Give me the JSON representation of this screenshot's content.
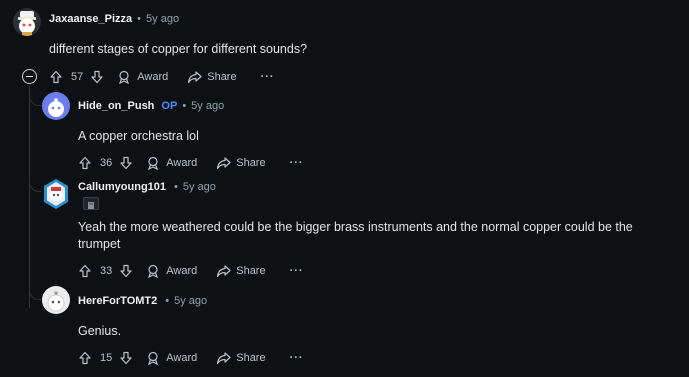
{
  "comments": [
    {
      "username": "Jaxaanse_Pizza",
      "op": "",
      "time": "5y ago",
      "body": "different stages of copper for different sounds?",
      "votes": "57",
      "award": "Award",
      "share": "Share",
      "more": "···"
    },
    {
      "username": "Hide_on_Push",
      "op": "OP",
      "time": "5y ago",
      "body": "A copper orchestra lol",
      "votes": "36",
      "award": "Award",
      "share": "Share",
      "more": "···"
    },
    {
      "username": "Callumyoung101",
      "op": "",
      "time": "5y ago",
      "body_line1": "Yeah the more weathered could be the bigger brass instruments and the normal copper could be the",
      "body_line2": "trumpet",
      "votes": "33",
      "award": "Award",
      "share": "Share",
      "more": "···"
    },
    {
      "username": "HereForTOMT2",
      "op": "",
      "time": "5y ago",
      "body": "Genius.",
      "votes": "15",
      "award": "Award",
      "share": "Share",
      "more": "···"
    }
  ],
  "separator": "•",
  "colors": {
    "background": "#0e1113",
    "op_blue": "#4d8ef7",
    "meta_gray": "#8ba2ad",
    "thread_line": "#2e3437"
  }
}
